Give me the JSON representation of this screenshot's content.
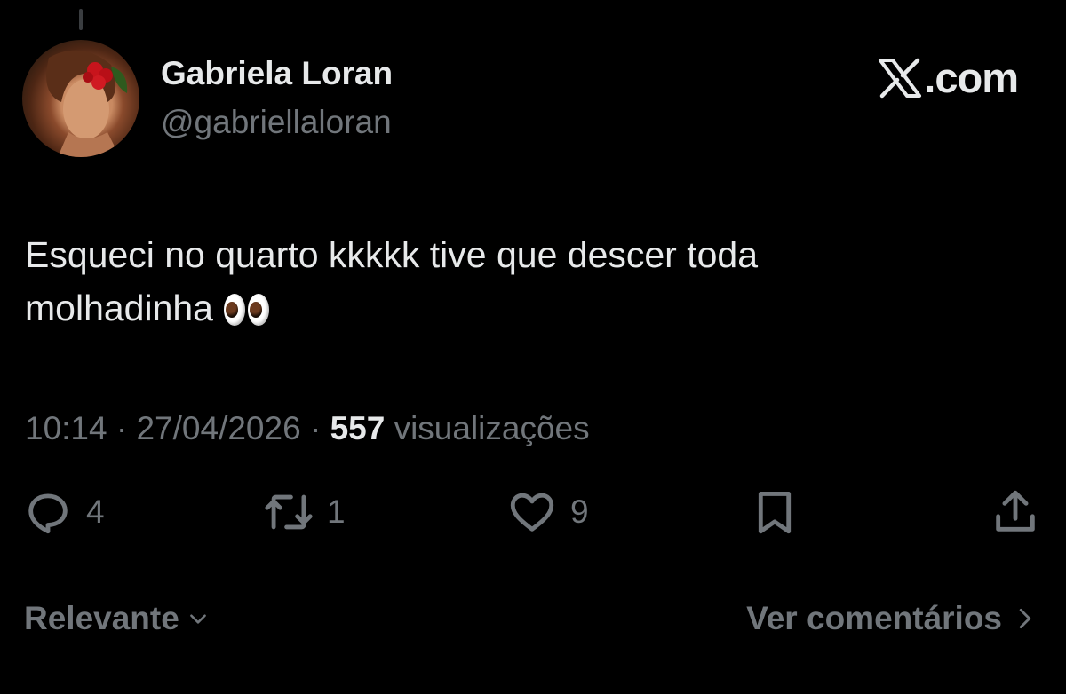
{
  "author": {
    "name": "Gabriela Loran",
    "handle": "@gabriellaloran"
  },
  "brand": {
    "label": ".com"
  },
  "tweet": {
    "text": "Esqueci no quarto kkkkk tive que descer toda\nmolhadinha",
    "emoji": "eyes"
  },
  "meta": {
    "time": "10:14",
    "sep1": " · ",
    "date": "27/04/2026",
    "sep2": " · ",
    "views_count": "557",
    "views_label": " visualizações"
  },
  "actions": {
    "replies": "4",
    "reposts": "1",
    "likes": "9"
  },
  "footer": {
    "sort_label": "Relevante",
    "comments_link": "Ver comentários"
  },
  "colors": {
    "background": "#000000",
    "text": "#e7e9ea",
    "muted": "#71767b"
  },
  "icons": [
    "reply-icon",
    "repost-icon",
    "like-icon",
    "bookmark-icon",
    "share-icon",
    "chevron-down-icon",
    "chevron-right-icon",
    "x-logo-icon"
  ]
}
